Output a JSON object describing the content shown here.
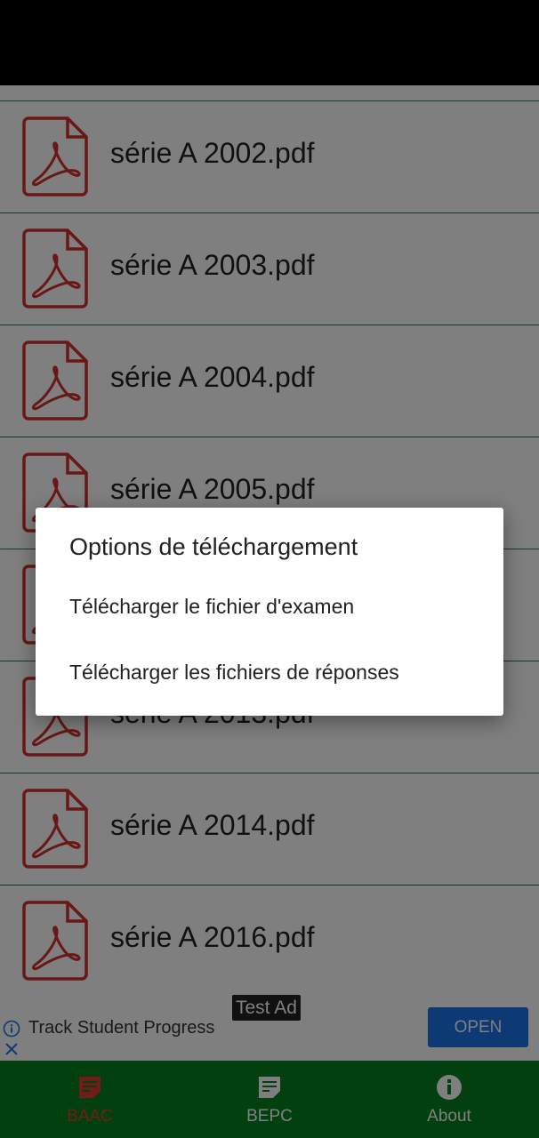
{
  "files": [
    {
      "name": "série A 2002.pdf",
      "icon": "pdf-icon"
    },
    {
      "name": "série A 2003.pdf",
      "icon": "pdf-icon"
    },
    {
      "name": "série A 2004.pdf",
      "icon": "pdf-icon"
    },
    {
      "name": "série A 2005.pdf",
      "icon": "pdf-icon"
    },
    {
      "name": "",
      "icon": "pdf-icon"
    },
    {
      "name": "série A 2013.pdf",
      "icon": "pdf-icon"
    },
    {
      "name": "série A 2014.pdf",
      "icon": "pdf-icon"
    },
    {
      "name": "série A 2016.pdf",
      "icon": "pdf-icon"
    }
  ],
  "ad": {
    "badge": "Test Ad",
    "title": "Track Student Progress",
    "button": "OPEN",
    "icons": [
      "info-icon",
      "close-icon"
    ]
  },
  "nav": [
    {
      "label": "BAAC",
      "icon": "document-icon",
      "active": true
    },
    {
      "label": "BEPC",
      "icon": "document-icon",
      "active": false
    },
    {
      "label": "About",
      "icon": "info-icon",
      "active": false
    }
  ],
  "dialog": {
    "title": "Options de téléchargement",
    "options": [
      "Télécharger le fichier d'examen",
      "Télécharger les fichiers de réponses"
    ]
  },
  "colors": {
    "primary": "#07801f",
    "pdf_red": "#d32f2f",
    "ad_button": "#1a73e8",
    "active_tab": "#e53935"
  }
}
